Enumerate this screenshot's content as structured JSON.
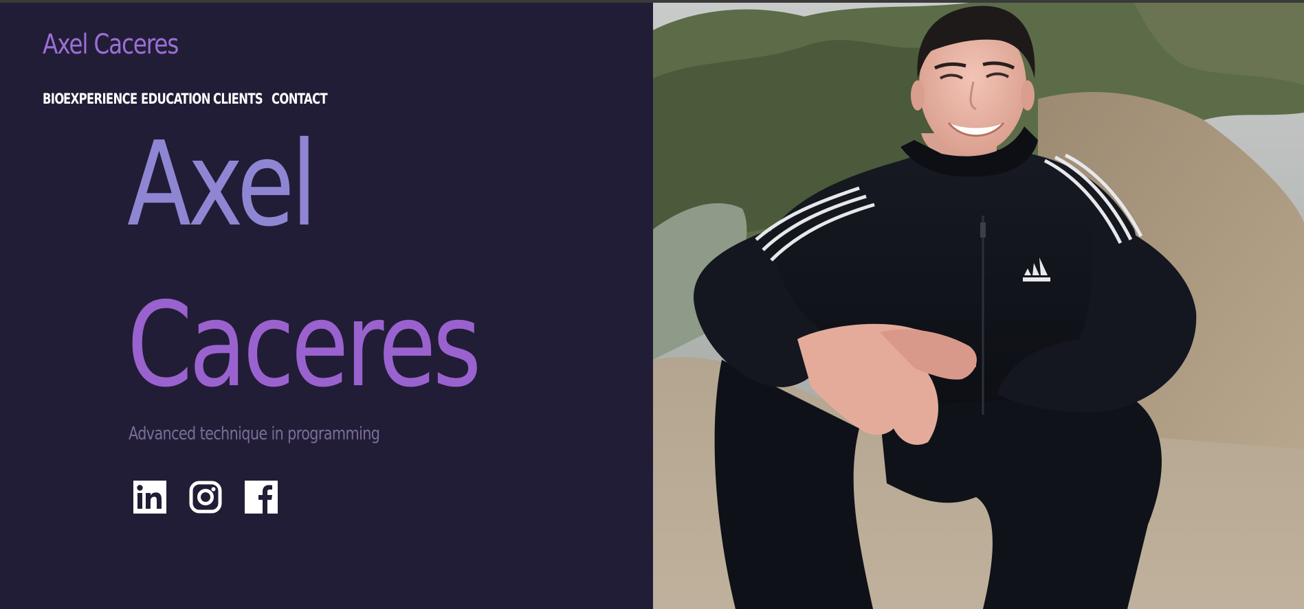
{
  "header": {
    "brand": "Axel Caceres",
    "nav": [
      {
        "label": "BIO"
      },
      {
        "label": "EXPERIENCE"
      },
      {
        "label": "EDUCATION"
      },
      {
        "label": "CLIENTS"
      },
      {
        "label": "CONTACT"
      }
    ]
  },
  "hero": {
    "first_name": "Axel",
    "last_name": "Caceres",
    "tagline": "Advanced technique in programming",
    "socials": [
      {
        "icon": "linkedin-icon"
      },
      {
        "icon": "instagram-icon"
      },
      {
        "icon": "facebook-icon"
      }
    ],
    "photo": {
      "logo_brand": "adidas"
    }
  },
  "colors": {
    "background": "#221d36",
    "brand": "#9b6fd6",
    "hero_first": "#8f86d3",
    "hero_last": "#9a62cf",
    "tagline": "#7a6e96",
    "nav_text": "#ffffff"
  }
}
